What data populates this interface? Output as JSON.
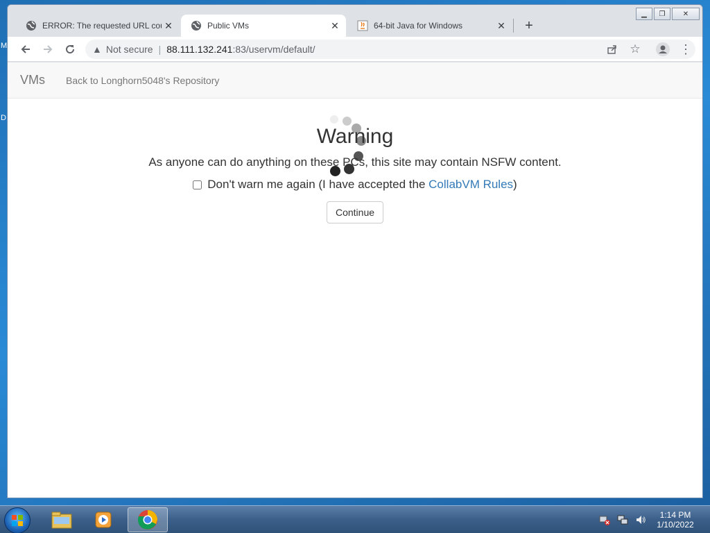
{
  "desktop": {
    "edge_labels": [
      "M",
      "D"
    ]
  },
  "window": {
    "controls": {
      "minimize": "▁",
      "maximize": "❐",
      "close": "✕"
    }
  },
  "tabs": [
    {
      "title": "ERROR: The requested URL could",
      "icon": "globe-icon",
      "active": false
    },
    {
      "title": "Public VMs",
      "icon": "globe-icon",
      "active": true
    },
    {
      "title": "64-bit Java for Windows",
      "icon": "java-icon",
      "active": false
    }
  ],
  "toolbar": {
    "security_label": "Not secure",
    "url_host": "88.111.132.241",
    "url_rest": ":83/uservm/default/"
  },
  "navbar": {
    "brand": "VMs",
    "link": "Back to Longhorn5048's Repository"
  },
  "dialog": {
    "title": "Warning",
    "message": "As anyone can do anything on these PCs, this site may contain NSFW content.",
    "checkbox_text": "Don't warn me again (I have accepted the",
    "rules_link": "CollabVM Rules",
    "checkbox_suffix": ")",
    "checkbox_checked": false,
    "continue_label": "Continue"
  },
  "taskbar": {
    "items": [
      "explorer-icon",
      "media-player-icon",
      "chrome-icon"
    ],
    "active_item": "chrome-icon",
    "tray_icons": [
      "network-error-icon",
      "network-icon",
      "volume-icon"
    ],
    "time": "1:14 PM",
    "date": "1/10/2022"
  }
}
